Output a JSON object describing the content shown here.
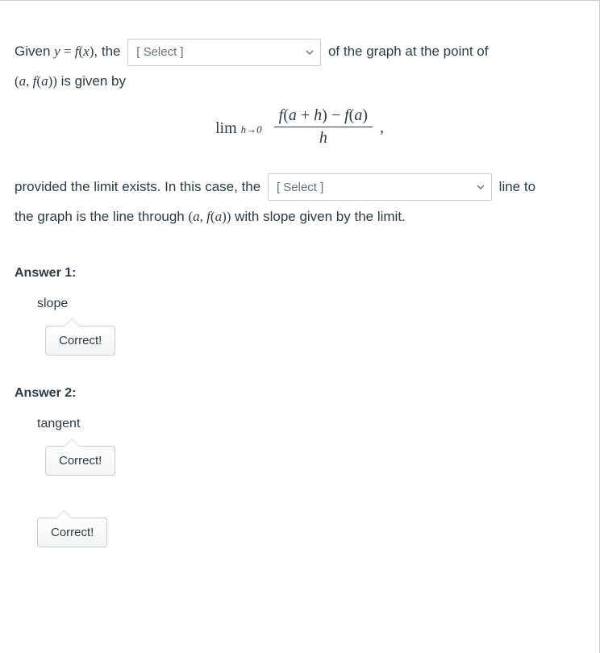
{
  "question": {
    "t1": "Given ",
    "t2": ", the",
    "t3": " of the graph at the point of",
    "t4": " is given by",
    "select1_placeholder": "[ Select ]",
    "t5": "provided the limit exists.  In this case, the",
    "select2_placeholder": "[ Select ]",
    "t6": " line to",
    "t7": "the graph is the line through ",
    "t8": " with slope given by the limit."
  },
  "formula": {
    "lim": "lim",
    "h0": "h→0",
    "num_left": "f",
    "num_paren_l": "(",
    "num_a": "a",
    "num_plus": " + ",
    "num_h": "h",
    "num_paren_r": ")",
    "num_minus": " − ",
    "num_f2": "f",
    "num_paren_l2": "(",
    "num_a2": "a",
    "num_paren_r2": ")",
    "den": "h",
    "comma": ","
  },
  "math": {
    "yf": {
      "y": "y",
      "eq": " = ",
      "f": "f",
      "l": "(",
      "x": "x",
      "r": ")"
    },
    "afa": {
      "l": "(",
      "a1": "a",
      "c": ", ",
      "f": "f",
      "l2": "(",
      "a2": "a",
      "r2": ")",
      "r": ")"
    }
  },
  "answers": {
    "heading1": "Answer 1:",
    "value1": "slope",
    "feedback1": "Correct!",
    "heading2": "Answer 2:",
    "value2": "tangent",
    "feedback2": "Correct!",
    "feedback3": "Correct!"
  }
}
